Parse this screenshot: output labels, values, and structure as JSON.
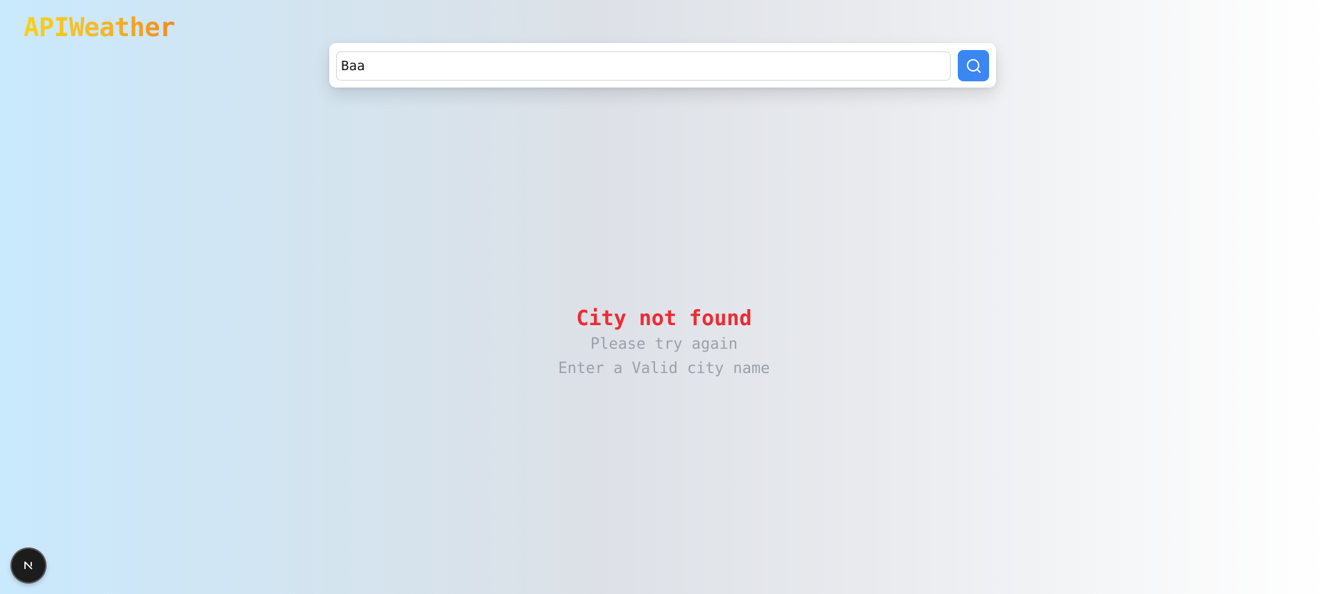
{
  "app": {
    "logo_text": "APIWeather"
  },
  "search": {
    "value": "Baa",
    "button_icon": "search-icon"
  },
  "error": {
    "title": "City not found",
    "line1": "Please try again",
    "line2": "Enter a Valid city name"
  },
  "dev_badge": {
    "icon": "nextjs-logo-icon"
  },
  "colors": {
    "accent": "#3a86f5",
    "error": "#ee2a33",
    "muted": "#9ba1a9",
    "logo_start": "#f8d118",
    "logo_end": "#f08c18"
  }
}
